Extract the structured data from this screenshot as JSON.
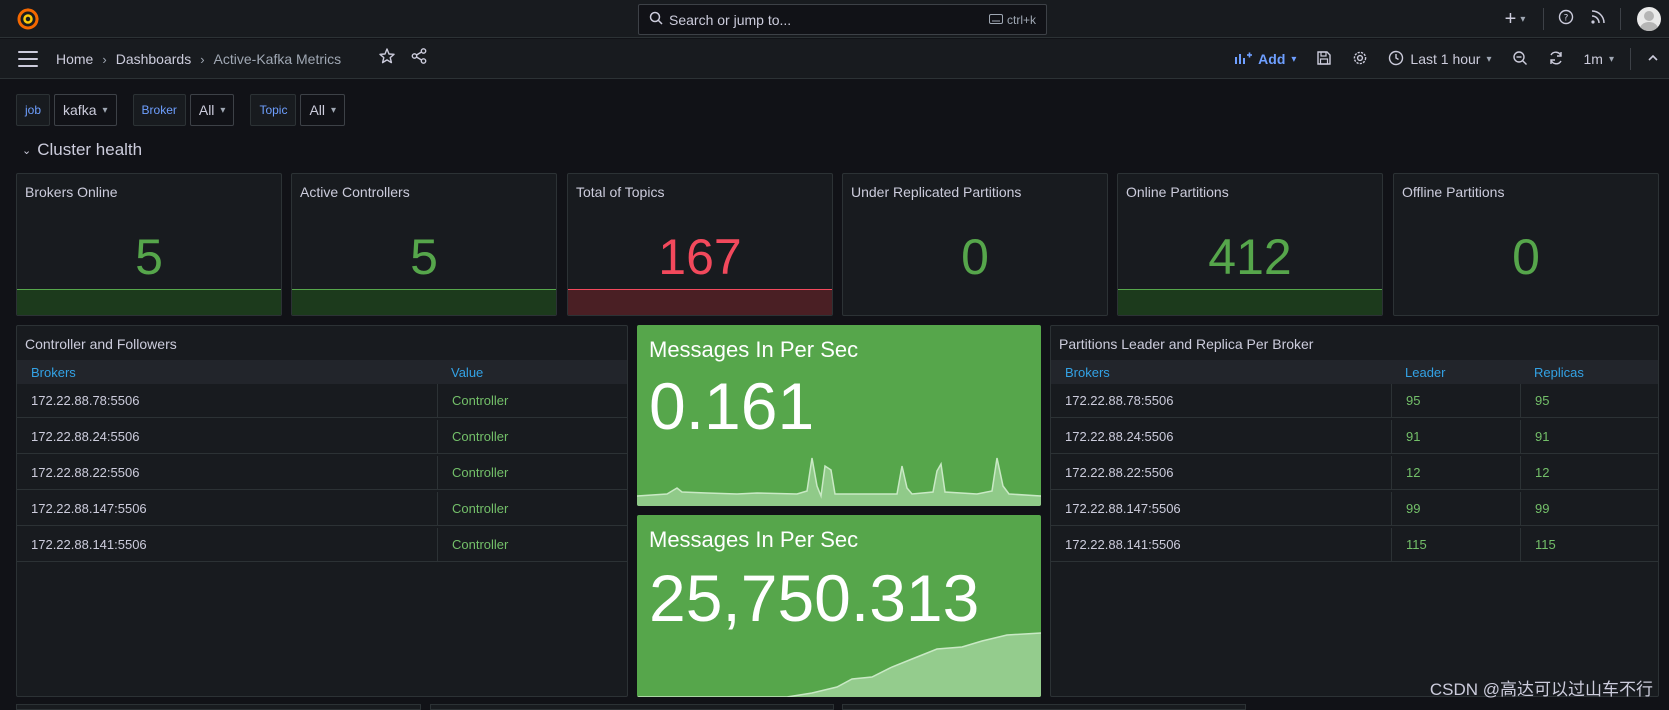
{
  "topbar": {
    "search_placeholder": "Search or jump to...",
    "shortcut": "ctrl+k"
  },
  "navbar": {
    "breadcrumbs": [
      "Home",
      "Dashboards",
      "Active-Kafka Metrics"
    ],
    "add_label": "Add",
    "time_range": "Last 1 hour",
    "refresh_interval": "1m"
  },
  "variables": [
    {
      "label": "job",
      "value": "kafka"
    },
    {
      "label": "Broker",
      "value": "All"
    },
    {
      "label": "Topic",
      "value": "All"
    }
  ],
  "row_title": "Cluster health",
  "stats": [
    {
      "title": "Brokers Online",
      "value": "5",
      "color": "#56a64b"
    },
    {
      "title": "Active Controllers",
      "value": "5",
      "color": "#56a64b"
    },
    {
      "title": "Total of Topics",
      "value": "167",
      "color": "#f2495c"
    },
    {
      "title": "Under Replicated Partitions",
      "value": "0",
      "color": "#56a64b"
    },
    {
      "title": "Online Partitions",
      "value": "412",
      "color": "#56a64b"
    },
    {
      "title": "Offline Partitions",
      "value": "0",
      "color": "#56a64b"
    }
  ],
  "controller_table": {
    "title": "Controller and Followers",
    "columns": [
      "Brokers",
      "Value"
    ],
    "rows": [
      [
        "172.22.88.78:5506",
        "Controller"
      ],
      [
        "172.22.88.24:5506",
        "Controller"
      ],
      [
        "172.22.88.22:5506",
        "Controller"
      ],
      [
        "172.22.88.147:5506",
        "Controller"
      ],
      [
        "172.22.88.141:5506",
        "Controller"
      ]
    ]
  },
  "messages_panels": [
    {
      "title": "Messages In Per Sec",
      "value": "0.161"
    },
    {
      "title": "Messages In Per Sec",
      "value": "25,750.313"
    }
  ],
  "partitions_table": {
    "title": "Partitions Leader and Replica Per Broker",
    "columns": [
      "Brokers",
      "Leader",
      "Replicas"
    ],
    "rows": [
      [
        "172.22.88.78:5506",
        "95",
        "95"
      ],
      [
        "172.22.88.24:5506",
        "91",
        "91"
      ],
      [
        "172.22.88.22:5506",
        "12",
        "12"
      ],
      [
        "172.22.88.147:5506",
        "99",
        "99"
      ],
      [
        "172.22.88.141:5506",
        "115",
        "115"
      ]
    ]
  },
  "colors": {
    "accent": "#6e9fff",
    "green": "#56a64b",
    "red": "#f2495c",
    "table_header": "#33a2e5"
  },
  "watermark": "CSDN @高达可以过山车不行"
}
